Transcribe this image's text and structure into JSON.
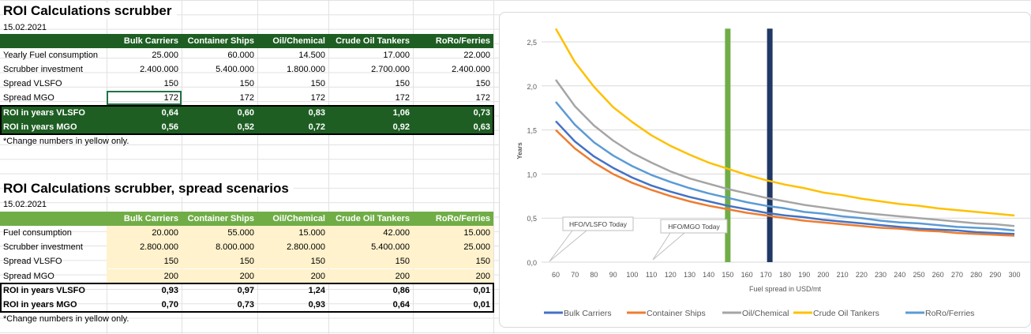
{
  "table1": {
    "title": "ROI Calculations scrubber",
    "date": "15.02.2021",
    "headers": [
      "",
      "Bulk Carriers",
      "Container Ships",
      "Oil/Chemical",
      "Crude Oil Tankers",
      "RoRo/Ferries"
    ],
    "rows": [
      [
        "Yearly Fuel consumption",
        "25.000",
        "60.000",
        "14.500",
        "17.000",
        "22.000"
      ],
      [
        "Scrubber investment",
        "2.400.000",
        "5.400.000",
        "1.800.000",
        "2.700.000",
        "2.400.000"
      ],
      [
        "Spread VLSFO",
        "150",
        "150",
        "150",
        "150",
        "150"
      ],
      [
        "Spread MGO",
        "172",
        "172",
        "172",
        "172",
        "172"
      ],
      [
        "ROI in years VLSFO",
        "0,64",
        "0,60",
        "0,83",
        "1,06",
        "0,73"
      ],
      [
        "ROI in years MGO",
        "0,56",
        "0,52",
        "0,72",
        "0,92",
        "0,63"
      ]
    ],
    "note": "*Change numbers in yellow only."
  },
  "table2": {
    "title": "ROI Calculations scrubber, spread scenarios",
    "date": "15.02.2021",
    "headers": [
      "",
      "Bulk Carriers",
      "Container Ships",
      "Oil/Chemical",
      "Crude Oil Tankers",
      "RoRo/Ferries"
    ],
    "rows": [
      [
        "Fuel consumption",
        "20.000",
        "55.000",
        "15.000",
        "42.000",
        "15.000"
      ],
      [
        "Scrubber investment",
        "2.800.000",
        "8.000.000",
        "2.800.000",
        "5.400.000",
        "25.000"
      ],
      [
        "Spread VLSFO",
        "150",
        "150",
        "150",
        "150",
        "150"
      ],
      [
        "Spread MGO",
        "200",
        "200",
        "200",
        "200",
        "200"
      ],
      [
        "ROI in years VLSFO",
        "0,93",
        "0,97",
        "1,24",
        "0,86",
        "0,01"
      ],
      [
        "ROI in years MGO",
        "0,70",
        "0,73",
        "0,93",
        "0,64",
        "0,01"
      ]
    ],
    "note": "*Change numbers in yellow only."
  },
  "colors": {
    "dark_green": "#1e5e23",
    "light_green": "#70ad47",
    "input_yellow": "#fff2cc"
  },
  "chart_data": {
    "type": "line",
    "xlabel": "Fuel spread in USD/mt",
    "ylabel": "Years",
    "x": [
      60,
      70,
      80,
      90,
      100,
      110,
      120,
      130,
      140,
      150,
      160,
      170,
      180,
      190,
      200,
      210,
      220,
      230,
      240,
      250,
      260,
      270,
      280,
      290,
      300
    ],
    "ylim": [
      0,
      2.5
    ],
    "yticks": [
      "0,0",
      "0,5",
      "1,0",
      "1,5",
      "2,0",
      "2,5"
    ],
    "grid": true,
    "legend": "bottom",
    "series": [
      {
        "name": "Bulk Carriers",
        "color": "#4472c4",
        "values": [
          1.6,
          1.37,
          1.2,
          1.07,
          0.96,
          0.87,
          0.8,
          0.74,
          0.69,
          0.64,
          0.6,
          0.56,
          0.53,
          0.51,
          0.48,
          0.46,
          0.44,
          0.42,
          0.4,
          0.38,
          0.37,
          0.36,
          0.34,
          0.33,
          0.32
        ]
      },
      {
        "name": "Container Ships",
        "color": "#ed7d31",
        "values": [
          1.5,
          1.29,
          1.13,
          1.0,
          0.9,
          0.82,
          0.75,
          0.69,
          0.64,
          0.6,
          0.56,
          0.53,
          0.5,
          0.47,
          0.45,
          0.43,
          0.41,
          0.39,
          0.38,
          0.36,
          0.35,
          0.33,
          0.32,
          0.31,
          0.3
        ]
      },
      {
        "name": "Oil/Chemical",
        "color": "#a5a5a5",
        "values": [
          2.07,
          1.77,
          1.55,
          1.38,
          1.24,
          1.13,
          1.03,
          0.95,
          0.89,
          0.83,
          0.78,
          0.73,
          0.69,
          0.65,
          0.62,
          0.59,
          0.56,
          0.54,
          0.52,
          0.5,
          0.48,
          0.46,
          0.44,
          0.43,
          0.41
        ]
      },
      {
        "name": "Crude Oil Tankers",
        "color": "#ffc000",
        "values": [
          2.65,
          2.27,
          1.99,
          1.76,
          1.59,
          1.44,
          1.32,
          1.22,
          1.13,
          1.06,
          0.99,
          0.93,
          0.88,
          0.84,
          0.79,
          0.76,
          0.72,
          0.69,
          0.66,
          0.64,
          0.61,
          0.59,
          0.57,
          0.55,
          0.53
        ]
      },
      {
        "name": "RoRo/Ferries",
        "color": "#5b9bd5",
        "values": [
          1.82,
          1.56,
          1.36,
          1.21,
          1.09,
          0.99,
          0.91,
          0.84,
          0.78,
          0.73,
          0.68,
          0.64,
          0.61,
          0.57,
          0.55,
          0.52,
          0.5,
          0.47,
          0.45,
          0.44,
          0.42,
          0.4,
          0.39,
          0.38,
          0.36
        ]
      }
    ],
    "markers": [
      {
        "x": 150,
        "color": "#70ad47",
        "label": "HFO/VLSFO Today"
      },
      {
        "x": 172,
        "color": "#203864",
        "label": "HFO/MGO Today"
      }
    ]
  }
}
